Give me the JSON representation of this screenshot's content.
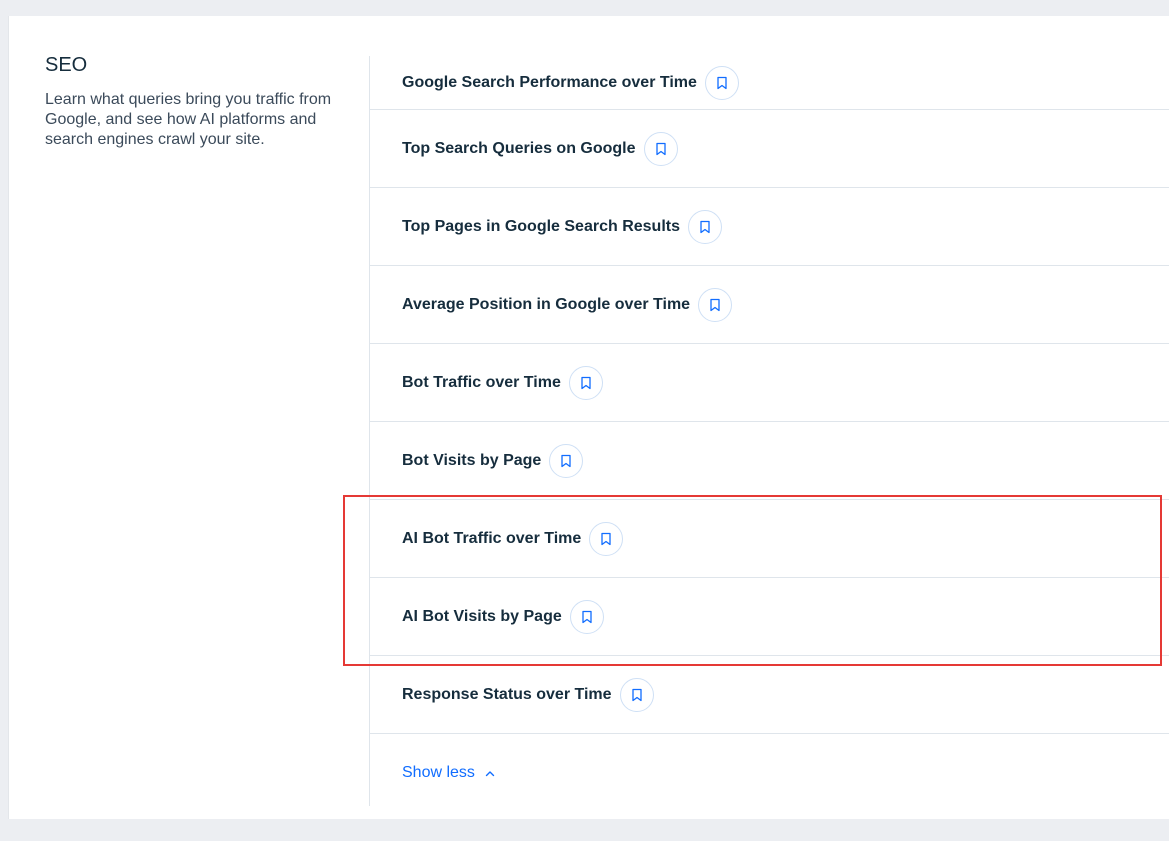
{
  "section": {
    "title": "SEO",
    "description": "Learn what queries bring you traffic from Google, and see how AI platforms and search engines crawl your site."
  },
  "reports": [
    {
      "label": "Google Search Performance over Time"
    },
    {
      "label": "Top Search Queries on Google"
    },
    {
      "label": "Top Pages in Google Search Results"
    },
    {
      "label": "Average Position in Google over Time"
    },
    {
      "label": "Bot Traffic over Time"
    },
    {
      "label": "Bot Visits by Page"
    },
    {
      "label": "AI Bot Traffic over Time"
    },
    {
      "label": "AI Bot Visits by Page"
    },
    {
      "label": "Response Status over Time"
    }
  ],
  "show_less": {
    "label": "Show less"
  },
  "colors": {
    "accent": "#116dff",
    "highlight": "#e53935",
    "text": "#162d3d",
    "divider": "#dfe5eb"
  }
}
